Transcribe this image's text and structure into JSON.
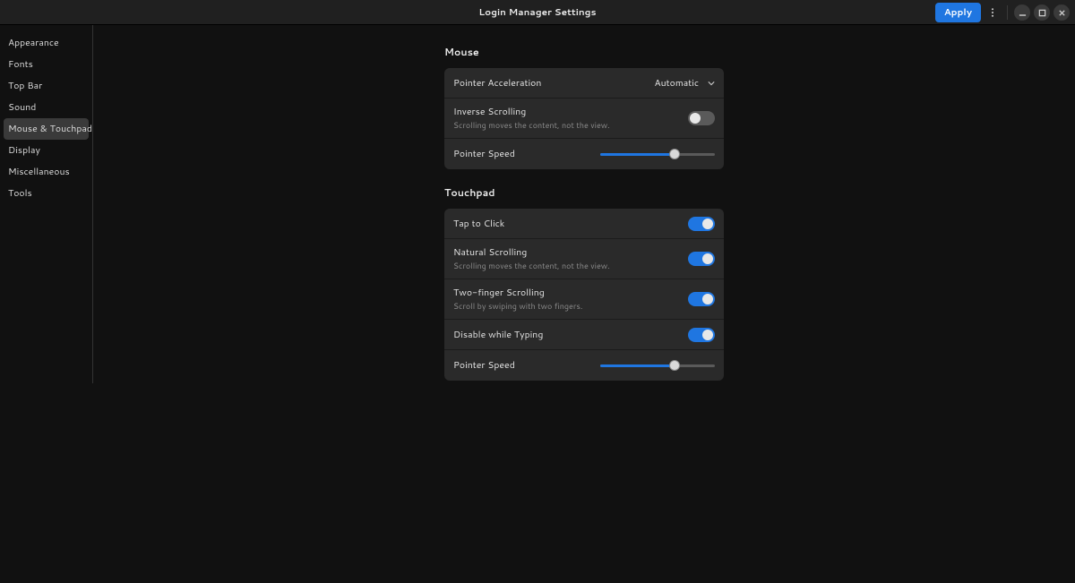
{
  "header": {
    "title": "Login Manager Settings",
    "apply_label": "Apply"
  },
  "sidebar": {
    "items": [
      {
        "label": "Appearance",
        "selected": false
      },
      {
        "label": "Fonts",
        "selected": false
      },
      {
        "label": "Top Bar",
        "selected": false
      },
      {
        "label": "Sound",
        "selected": false
      },
      {
        "label": "Mouse & Touchpad",
        "selected": true
      },
      {
        "label": "Display",
        "selected": false
      },
      {
        "label": "Miscellaneous",
        "selected": false
      },
      {
        "label": "Tools",
        "selected": false
      }
    ]
  },
  "mouse": {
    "section_title": "Mouse",
    "pointer_accel": {
      "label": "Pointer Acceleration",
      "value": "Automatic"
    },
    "inverse_scroll": {
      "label": "Inverse Scrolling",
      "sub": "Scrolling moves the content, not the view.",
      "on": false
    },
    "speed": {
      "label": "Pointer Speed",
      "pct": 65
    }
  },
  "touchpad": {
    "section_title": "Touchpad",
    "tap_click": {
      "label": "Tap to Click",
      "on": true
    },
    "natural_scroll": {
      "label": "Natural Scrolling",
      "sub": "Scrolling moves the content, not the view.",
      "on": true
    },
    "two_finger": {
      "label": "Two-finger Scrolling",
      "sub": "Scroll by swiping with two fingers.",
      "on": true
    },
    "disable_typing": {
      "label": "Disable while Typing",
      "on": true
    },
    "speed": {
      "label": "Pointer Speed",
      "pct": 65
    }
  }
}
